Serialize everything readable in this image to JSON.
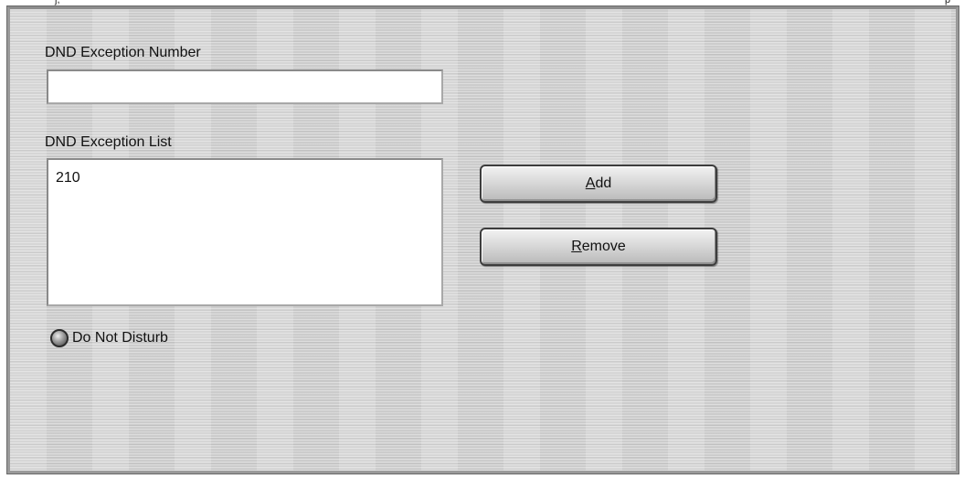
{
  "top_strip": {
    "left_glyph": "j,",
    "right_glyph": "p"
  },
  "form": {
    "number_label": "DND Exception Number",
    "number_value": "",
    "list_label": "DND Exception List",
    "list_items": [
      "210"
    ],
    "dnd_label": "Do Not Disturb"
  },
  "buttons": {
    "add_mnemonic": "A",
    "add_rest": "dd",
    "remove_mnemonic": "R",
    "remove_rest": "emove"
  },
  "colors": {
    "panel_bg": "#d3d3d3",
    "field_bg": "#ffffff",
    "button_border": "#3d3d3d"
  }
}
